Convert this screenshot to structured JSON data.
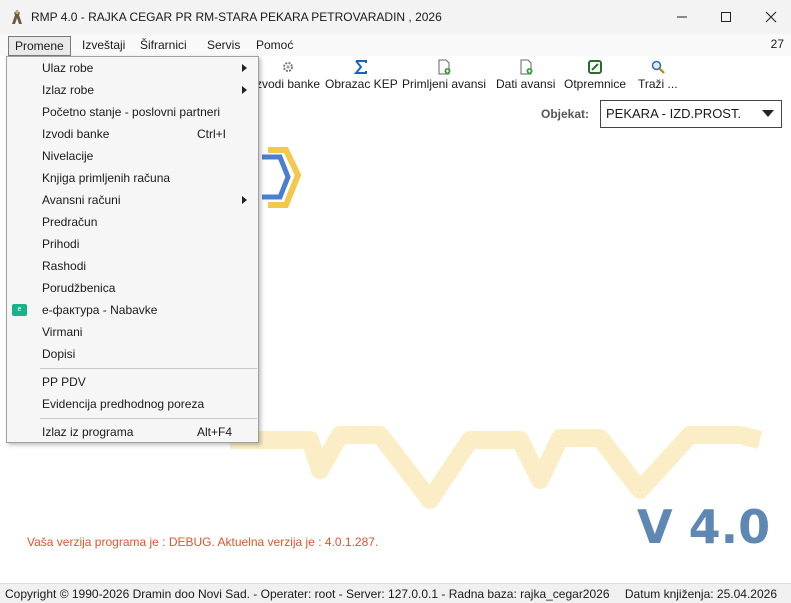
{
  "window": {
    "title": "RMP 4.0 - RAJKA CEGAR PR RM-STARA PEKARA PETROVARADIN , 2026",
    "app_icon": "rmp-app-icon",
    "controls": {
      "minimize": "minimize-icon",
      "maximize": "maximize-icon",
      "close": "close-icon"
    }
  },
  "menubar": {
    "items": [
      "Promene",
      "Izveštaji",
      "Šifrarnici",
      "Servis",
      "Pomoć"
    ],
    "right_number": "27"
  },
  "toolbar": {
    "buttons": [
      {
        "label": "zvodi banke",
        "icon": "gear-icon"
      },
      {
        "label": "Obrazac KEP",
        "icon": "sigma-icon"
      },
      {
        "label": "Primljeni avansi",
        "icon": "document-add-icon"
      },
      {
        "label": "Dati avansi",
        "icon": "document-add-icon"
      },
      {
        "label": "Otpremnice",
        "icon": "edit-icon"
      },
      {
        "label": "Traži ...",
        "icon": "search-icon"
      }
    ]
  },
  "objekat": {
    "label": "Objekat:",
    "value": "PEKARA - IZD.PROST."
  },
  "dropdown": {
    "items": [
      {
        "label": "Ulaz robe",
        "submenu": true
      },
      {
        "label": "Izlaz robe",
        "submenu": true
      },
      {
        "label": "Početno stanje - poslovni partneri"
      },
      {
        "label": "Izvodi banke",
        "shortcut": "Ctrl+I"
      },
      {
        "label": "Nivelacije"
      },
      {
        "label": "Knjiga primljenih računa"
      },
      {
        "label": "Avansni računi",
        "submenu": true
      },
      {
        "label": "Predračun"
      },
      {
        "label": "Prihodi"
      },
      {
        "label": "Rashodi"
      },
      {
        "label": "Porudžbenica"
      },
      {
        "label": "е-фактура - Nabavke",
        "icon": "e-faktura-icon"
      },
      {
        "label": "Virmani"
      },
      {
        "label": "Dopisi"
      },
      {
        "label": "PP PDV"
      },
      {
        "label": "Evidencija predhodnog poreza"
      },
      {
        "label": "Izlaz iz programa",
        "shortcut": "Alt+F4"
      }
    ]
  },
  "main": {
    "debug_text": "Vaša verzija programa je : DEBUG. Aktuelna verzija je : 4.0.1.287.",
    "version_text": "V 4.0"
  },
  "statusbar": {
    "left": "Copyright © 1990-2026 Dramin doo Novi Sad. - Operater: root - Server: 127.0.0.1 - Radna baza: rajka_cegar2026",
    "right": "Datum knjiženja: 25.04.2026"
  },
  "colors": {
    "accent_blue": "#5f87b3",
    "debug_red": "#e2542c",
    "efaktura_green": "#1ab28a",
    "art_yellow": "#fbeec6"
  }
}
